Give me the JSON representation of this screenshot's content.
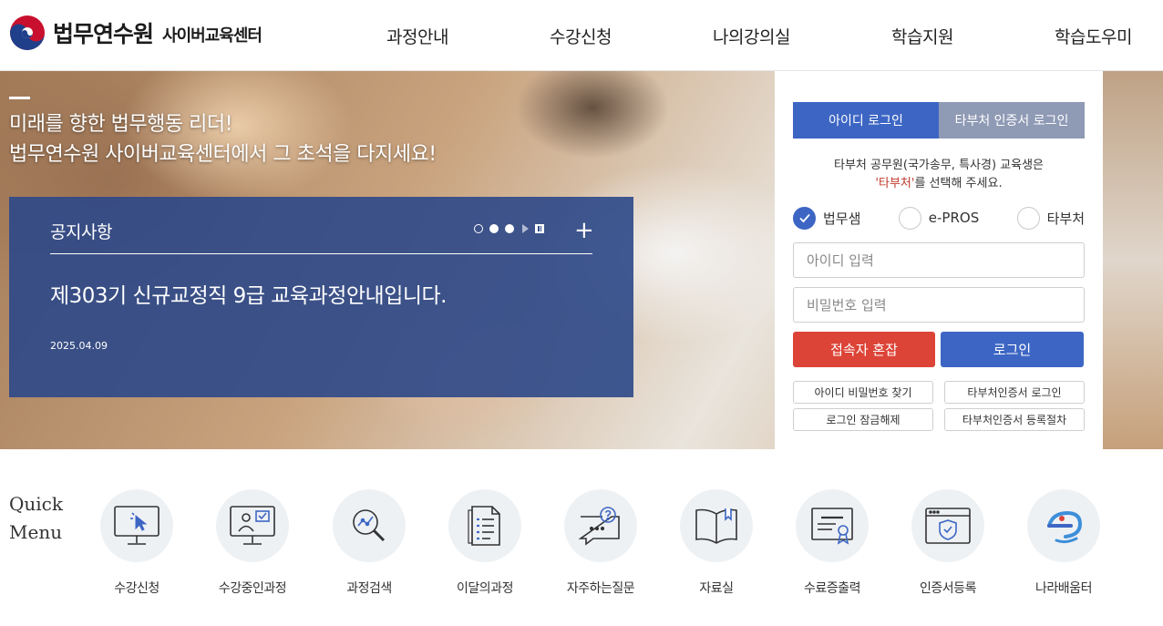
{
  "header": {
    "logo_main": "법무연수원",
    "logo_sub": "사이버교육센터",
    "nav": [
      "과정안내",
      "수강신청",
      "나의강의실",
      "학습지원",
      "학습도우미"
    ]
  },
  "hero": {
    "slogan_line1": "미래를 향한 법무행동 리더!",
    "slogan_line2": "법무연수원 사이버교육센터에서 그 초석을 다지세요!",
    "notice": {
      "title": "공지사항",
      "more": "+",
      "headline": "제303기 신규교정직 9급 교육과정안내입니다.",
      "date": "2025.04.09"
    }
  },
  "login": {
    "tabs": [
      "아이디 로그인",
      "타부처 인증서 로그인"
    ],
    "active_tab": "아이디 로그인",
    "guide_line1": "타부처 공무원(국가송무, 특사경) 교육생은",
    "guide_highlight": "'타부처'",
    "guide_line2_rest": "를 선택해 주세요.",
    "radios": [
      {
        "label": "법무샘",
        "checked": true
      },
      {
        "label": "e-PROS",
        "checked": false
      },
      {
        "label": "타부처",
        "checked": false
      }
    ],
    "id_placeholder": "아이디 입력",
    "pw_placeholder": "비밀번호 입력",
    "congestion_button": "접속자 혼잡",
    "login_button": "로그인",
    "links": [
      "아이디 비밀번호 찾기",
      "타부처인증서 로그인",
      "로그인 잠금해제",
      "타부처인증서 등록절차"
    ]
  },
  "quick_menu": {
    "title_line1": "Quick",
    "title_line2": "Menu",
    "items": [
      {
        "label": "수강신청",
        "icon": "monitor-cursor-icon"
      },
      {
        "label": "수강중인과정",
        "icon": "monitor-person-icon"
      },
      {
        "label": "과정검색",
        "icon": "search-chart-icon"
      },
      {
        "label": "이달의과정",
        "icon": "document-list-icon"
      },
      {
        "label": "자주하는질문",
        "icon": "chat-question-icon"
      },
      {
        "label": "자료실",
        "icon": "book-icon"
      },
      {
        "label": "수료증출력",
        "icon": "certificate-icon"
      },
      {
        "label": "인증서등록",
        "icon": "browser-shield-icon"
      },
      {
        "label": "나라배움터",
        "icon": "narabaeumteo-logo-icon"
      }
    ]
  },
  "colors": {
    "primary_blue": "#3d66c4",
    "notice_bg": "#2c4888",
    "red": "#dc4437",
    "inactive_tab": "#8f9ab5"
  }
}
